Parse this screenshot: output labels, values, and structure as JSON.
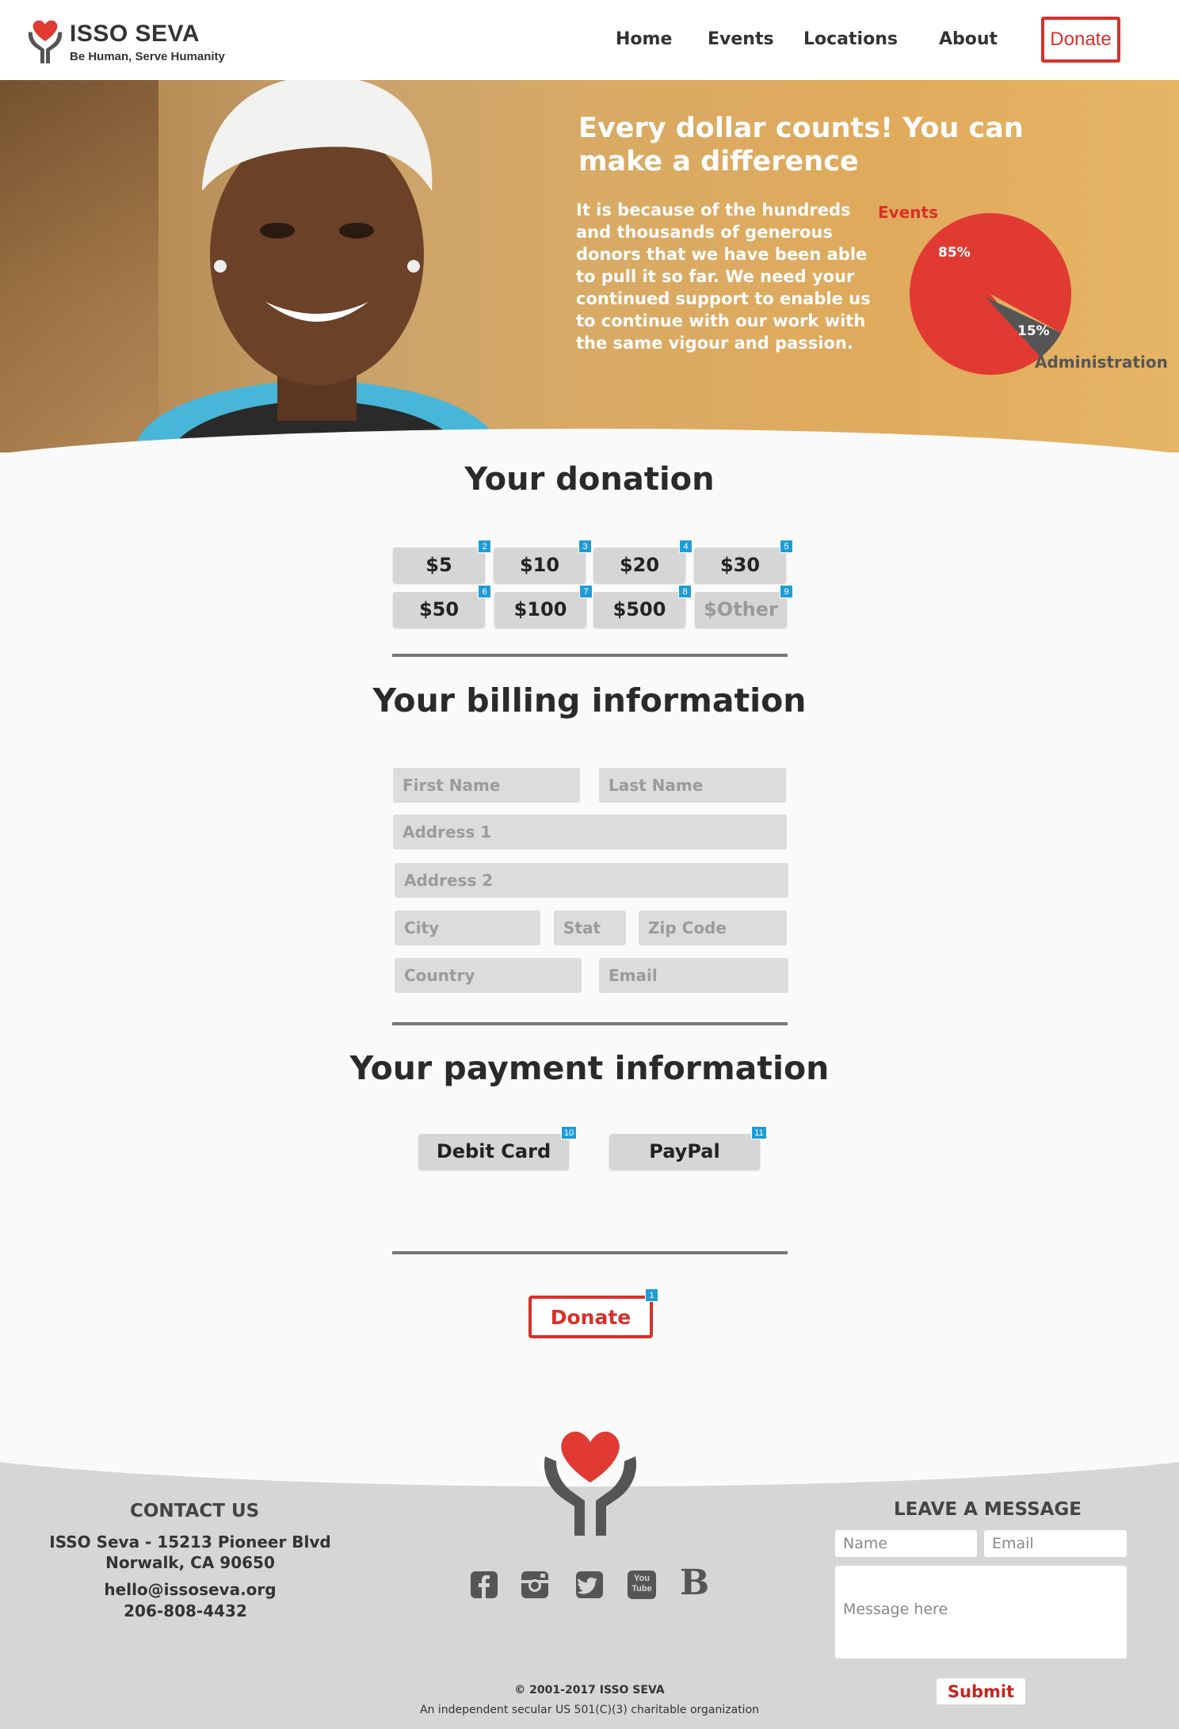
{
  "nav": {
    "brand": "ISSO SEVA",
    "tagline": "Be Human, Serve Humanity",
    "links": [
      "Home",
      "Events",
      "Locations",
      "About"
    ],
    "donate_label": "Donate"
  },
  "hero": {
    "title": "Every dollar counts! You can make a difference",
    "text": "It is because of the hundreds and thousands of generous donors that we have been able to pull it so far. We need your continued support to enable us to continue with our work with the same vigour and passion.",
    "chart": {
      "slices": [
        {
          "label": "Events",
          "percent_label": "85%",
          "value": 85,
          "color": "#e03a33"
        },
        {
          "label": "Administration",
          "percent_label": "15%",
          "value": 15,
          "color": "#555555"
        }
      ]
    }
  },
  "donation": {
    "heading": "Your donation",
    "amounts": [
      {
        "label": "$5",
        "badge": "2"
      },
      {
        "label": "$10",
        "badge": "3"
      },
      {
        "label": "$20",
        "badge": "4"
      },
      {
        "label": "$30",
        "badge": "5"
      },
      {
        "label": "$50",
        "badge": "6"
      },
      {
        "label": "$100",
        "badge": "7"
      },
      {
        "label": "$500",
        "badge": "8"
      },
      {
        "label": "$Other",
        "badge": "9"
      }
    ]
  },
  "billing": {
    "heading": "Your billing information",
    "placeholders": {
      "first_name": "First Name",
      "last_name": "Last Name",
      "address1": "Address 1",
      "address2": "Address 2",
      "city": "City",
      "state": "Stat",
      "zip": "Zip Code",
      "country": "Country",
      "email": "Email"
    }
  },
  "payment": {
    "heading": "Your payment information",
    "methods": [
      {
        "label": "Debit Card",
        "badge": "10"
      },
      {
        "label": "PayPal",
        "badge": "11"
      }
    ]
  },
  "donate_button": {
    "label": "Donate",
    "badge": "1"
  },
  "footer": {
    "contact_heading": "CONTACT US",
    "address_line1": "ISSO Seva - 15213 Pioneer Blvd",
    "address_line2": "Norwalk, CA 90650",
    "email": "hello@issoseva.org",
    "phone": "206-808-4432",
    "social_icons": [
      "facebook-icon",
      "instagram-icon",
      "twitter-icon",
      "youtube-icon",
      "blogger-icon"
    ],
    "youtube_text": "You Tube",
    "blogger_text": "B",
    "message_heading": "LEAVE A MESSAGE",
    "name_placeholder": "Name",
    "email_placeholder": "Email",
    "message_placeholder": "Message here",
    "submit_label": "Submit",
    "copyright": "© 2001-2017 ISSO SEVA",
    "org_line": "An independent secular US 501(C)(3) charitable organization"
  },
  "colors": {
    "brand_red": "#d8302a",
    "badge_blue": "#1e9cd7",
    "footer_gray": "#d6d6d6"
  }
}
